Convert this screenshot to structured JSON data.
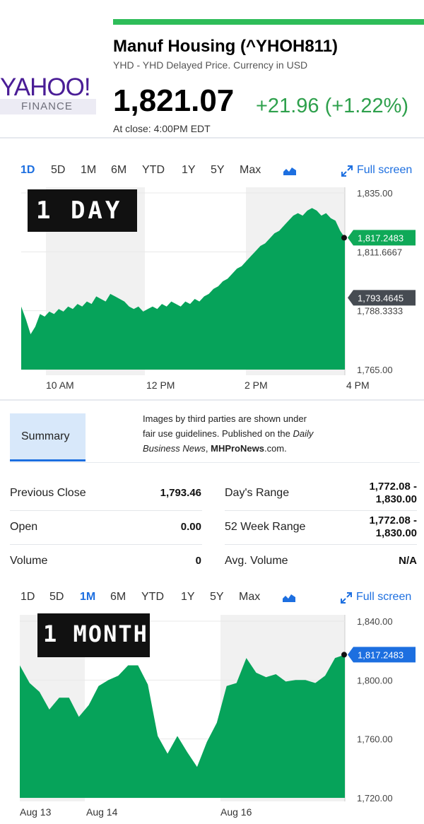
{
  "header": {
    "logo_main": "YAHOO!",
    "logo_sub": "FINANCE",
    "title": "Manuf Housing (^YHOH811)",
    "subtitle": "YHD - YHD Delayed Price. Currency in USD",
    "price": "1,821.07",
    "change": "+21.96 (+1.22%)",
    "close_time": "At close: 4:00PM EDT"
  },
  "ranges": [
    "1D",
    "5D",
    "1M",
    "6M",
    "YTD",
    "1Y",
    "5Y",
    "Max"
  ],
  "fullscreen_label": "Full screen",
  "day_chart": {
    "banner": "1 DAY",
    "active_range": "1D",
    "chart_data": {
      "type": "area",
      "x_labels": [
        "10 AM",
        "12 PM",
        "2 PM",
        "4 PM"
      ],
      "y_ticks": [
        "1,835.00",
        "1,811.6667",
        "1,788.3333",
        "1,765.00"
      ],
      "ylim": [
        1765,
        1835
      ],
      "current_value": "1,817.2483",
      "previous_close_value": "1,793.4645",
      "current": 1817.2483,
      "previous_close": 1793.4645,
      "values": [
        1790,
        1785,
        1779,
        1782,
        1787,
        1786,
        1788,
        1787,
        1789,
        1788,
        1790,
        1789,
        1791,
        1790,
        1792,
        1791,
        1794,
        1793,
        1792,
        1795,
        1794,
        1793,
        1792,
        1790,
        1789,
        1790,
        1788,
        1789,
        1790,
        1789,
        1791,
        1790,
        1792,
        1791,
        1790,
        1792,
        1791,
        1793,
        1792,
        1794,
        1795,
        1797,
        1798,
        1800,
        1801,
        1803,
        1805,
        1806,
        1808,
        1810,
        1812,
        1814,
        1815,
        1817,
        1819,
        1820,
        1822,
        1824,
        1826,
        1827,
        1826,
        1828,
        1829,
        1828,
        1826,
        1827,
        1825,
        1824,
        1820,
        1817.25
      ],
      "color": "#06a35a"
    }
  },
  "summary": {
    "tab_label": "Summary",
    "credit_line1": "Images by third parties are shown under",
    "credit_line2_a": "fair use guidelines.  Published on the ",
    "credit_line2_b": "Daily",
    "credit_line3_a": "Business News",
    "credit_line3_b": ", ",
    "credit_line3_c": "MHProNews",
    "credit_line3_d": ".com.",
    "rows": [
      {
        "label": "Previous Close",
        "value": "1,793.46"
      },
      {
        "label": "Open",
        "value": "0.00"
      },
      {
        "label": "Volume",
        "value": "0"
      }
    ],
    "rows_right": [
      {
        "label": "Day's Range",
        "value1": "1,772.08 -",
        "value2": "1,830.00"
      },
      {
        "label": "52 Week Range",
        "value1": "1,772.08 -",
        "value2": "1,830.00"
      },
      {
        "label": "Avg. Volume",
        "value1": "N/A",
        "value2": ""
      }
    ]
  },
  "month_chart": {
    "banner": "1 MONTH",
    "active_range": "1M",
    "chart_data": {
      "type": "area",
      "x_labels": [
        "Aug 13",
        "Aug 14",
        "Aug 16"
      ],
      "y_ticks": [
        "1,840.00",
        "1,800.00",
        "1,760.00",
        "1,720.00"
      ],
      "ylim": [
        1720,
        1840
      ],
      "current_value": "1,817.2483",
      "current": 1817.2483,
      "values": [
        1810,
        1798,
        1792,
        1780,
        1788,
        1788,
        1775,
        1783,
        1796,
        1800,
        1803,
        1810,
        1810,
        1797,
        1762,
        1750,
        1762,
        1751,
        1741,
        1758,
        1771,
        1796,
        1798,
        1815,
        1805,
        1802,
        1804,
        1799,
        1800,
        1800,
        1798,
        1803,
        1815,
        1817.25
      ],
      "color": "#06a35a"
    }
  }
}
